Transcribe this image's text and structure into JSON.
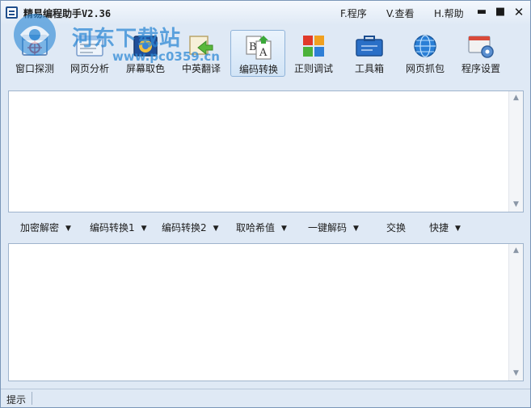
{
  "window": {
    "title": "精易编程助手V2.36",
    "menus": [
      "F.程序",
      "V.查看",
      "H.帮助"
    ],
    "controls": {
      "minimize": "▬",
      "maximize": "■",
      "close": "✕"
    }
  },
  "watermark": {
    "line1": "河东下载站",
    "line2": "www.pc0359.cn"
  },
  "toolbar": {
    "items": [
      {
        "label": "窗口探测",
        "icon": "window-detect-icon"
      },
      {
        "label": "网页分析",
        "icon": "webpage-analysis-icon"
      },
      {
        "label": "屏幕取色",
        "icon": "color-picker-icon"
      },
      {
        "label": "中英翻译",
        "icon": "translate-icon"
      },
      {
        "label": "编码转换",
        "icon": "encode-convert-icon",
        "active": true
      },
      {
        "label": "正则调试",
        "icon": "regex-debug-icon"
      },
      {
        "label": "工具箱",
        "icon": "toolbox-icon"
      },
      {
        "label": "网页抓包",
        "icon": "web-capture-icon"
      },
      {
        "label": "程序设置",
        "icon": "settings-icon"
      }
    ]
  },
  "editor": {
    "input_text": "",
    "output_text": ""
  },
  "actions": {
    "items": [
      {
        "label": "加密解密",
        "dropdown": true
      },
      {
        "label": "编码转换1",
        "dropdown": true
      },
      {
        "label": "编码转换2",
        "dropdown": true
      },
      {
        "label": "取哈希值",
        "dropdown": true
      },
      {
        "label": "一键解码",
        "dropdown": true
      },
      {
        "label": "交换",
        "dropdown": false
      },
      {
        "label": "快捷",
        "dropdown": true
      }
    ]
  },
  "status": {
    "text": "提示"
  },
  "colors": {
    "window_bg": "#dfe9f5",
    "border": "#7a96b8",
    "watermark": "#2f8ad6"
  }
}
